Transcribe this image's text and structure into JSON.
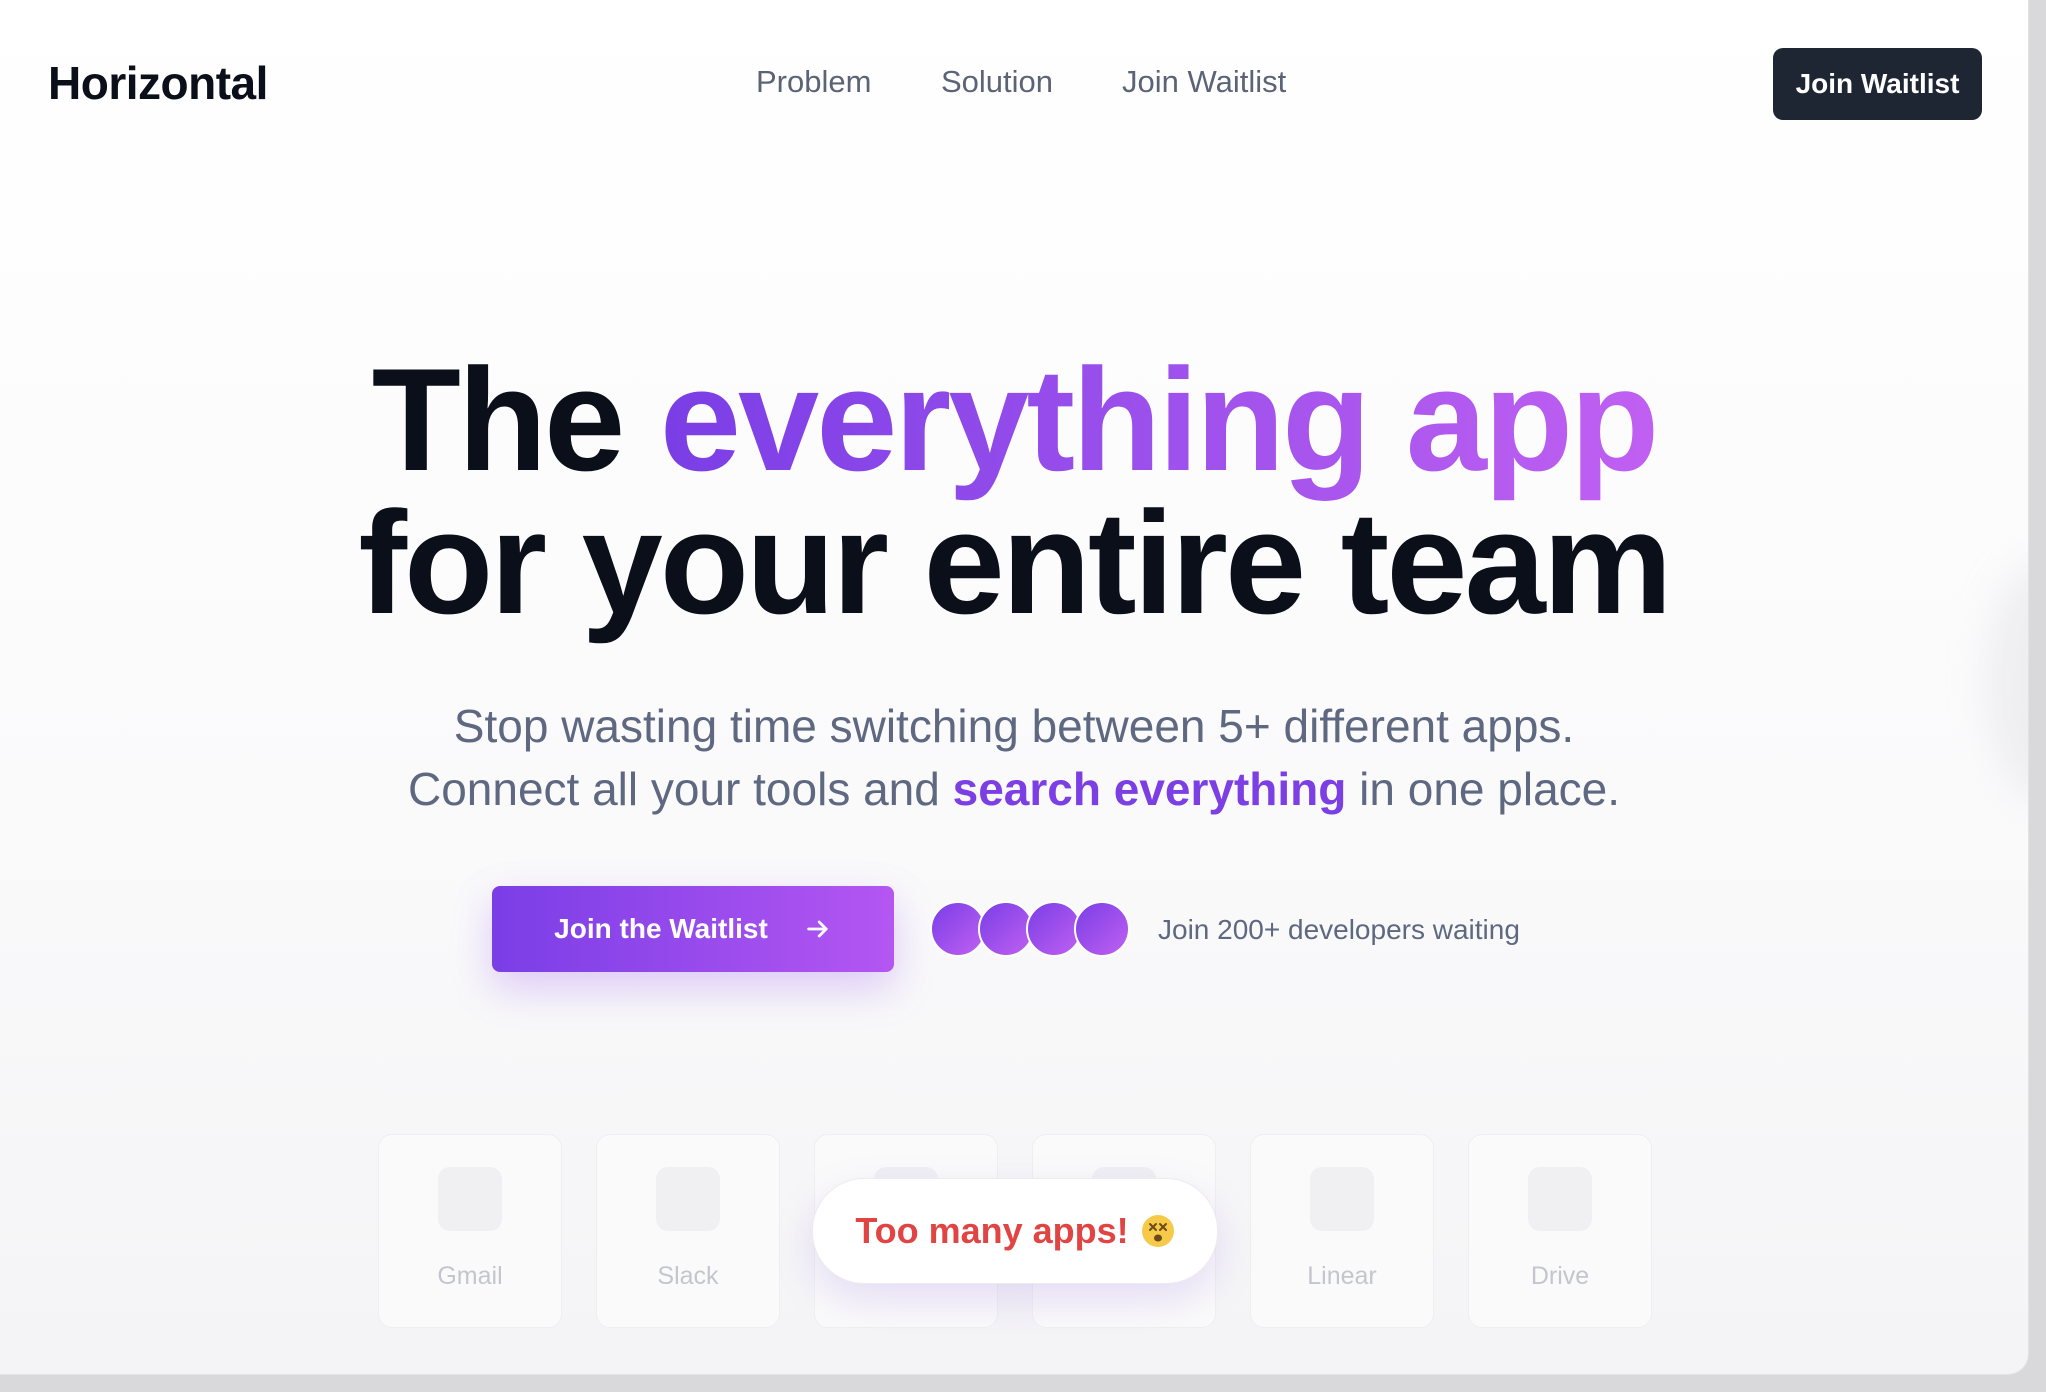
{
  "brand": {
    "name": "Horizontal"
  },
  "nav": {
    "links": [
      "Problem",
      "Solution",
      "Join Waitlist"
    ],
    "cta_label": "Join Waitlist"
  },
  "hero": {
    "line1_plain": "The ",
    "line1_highlight": "everything app",
    "line2": "for your entire team",
    "sub_line1": "Stop wasting time switching between 5+ different apps.",
    "sub_line2_before": "Connect all your tools and ",
    "sub_line2_highlight": "search everything",
    "sub_line2_after": " in one place."
  },
  "cta": {
    "label": "Join the Waitlist",
    "icon": "arrow-right-icon",
    "social_proof": "Join 200+ developers waiting",
    "avatar_count": 4
  },
  "apps": {
    "cards": [
      "Gmail",
      "Slack",
      "",
      "",
      "Linear",
      "Drive"
    ],
    "badge_text": "Too many apps!",
    "badge_icon": "dizzy-face-icon"
  },
  "colors": {
    "accent_start": "#7a3ee6",
    "accent_end": "#c060f2",
    "dark_button": "#1f2633",
    "heading": "#0b0f19",
    "muted": "#5e6880",
    "warning_text": "#e04543"
  }
}
